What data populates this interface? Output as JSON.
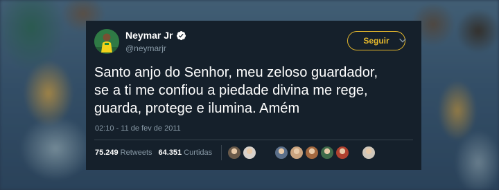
{
  "tweet": {
    "author_name": "Neymar Jr",
    "author_handle": "@neymarjr",
    "verified": true,
    "follow_label": "Seguir",
    "text_lines": [
      "Santo anjo do Senhor, meu zeloso guardador,",
      "se a ti me confiou a piedade divina me rege,",
      "guarda, protege e ilumina. Amém"
    ],
    "timestamp": "02:10 - 11 de fev de 2011",
    "retweets_count": "75.249",
    "retweets_label": "Retweets",
    "likes_count": "64.351",
    "likes_label": "Curtidas"
  },
  "colors": {
    "card_bg": "#15202b",
    "accent": "#e5b82c",
    "text_primary": "#ffffff",
    "text_secondary": "#8899a6",
    "verified_blue": "#ffffff"
  },
  "icons": {
    "verified": "verified-badge-icon",
    "chevron": "chevron-down-icon"
  },
  "liker_avatars": [
    {
      "color": "#6a5a4a"
    },
    {
      "color": "#d8d2cc"
    },
    {
      "color": "#5b6f8a"
    },
    {
      "color": "#c9a37f"
    },
    {
      "color": "#a3683f"
    },
    {
      "color": "#3f6a4a"
    },
    {
      "color": "#b0412f"
    },
    {
      "color": "#cfc7bb"
    },
    {
      "color": "#9b8f86"
    }
  ]
}
